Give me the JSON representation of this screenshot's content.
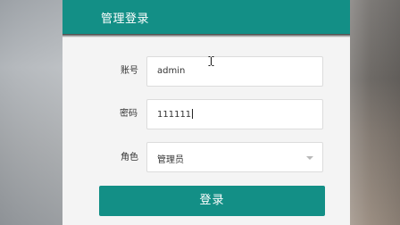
{
  "header": {
    "title": "管理登录"
  },
  "form": {
    "account": {
      "label": "账号",
      "value": "admin"
    },
    "password": {
      "label": "密码",
      "value": "111111"
    },
    "role": {
      "label": "角色",
      "selected": "管理员"
    }
  },
  "login_button": {
    "label": "登录"
  },
  "colors": {
    "accent": "#138f86",
    "panel": "#f4f4f4"
  },
  "icons": {
    "dropdown": "chevron-down-icon",
    "cursor": "text-cursor-icon"
  }
}
